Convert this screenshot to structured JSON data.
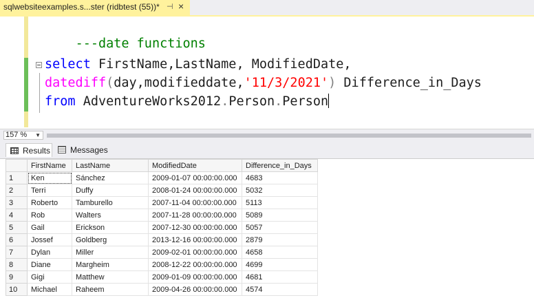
{
  "tab": {
    "title": "sqlwebsiteexamples.s...ster (ridbtest (55))*",
    "pin_glyph": "⊣",
    "close_glyph": "×"
  },
  "editor": {
    "comment": "---date functions",
    "line2": {
      "kw": "select",
      "rest": " FirstName,LastName, ModifiedDate,"
    },
    "line3": {
      "fn": "datediff",
      "p1": "(",
      "a1": "day,modifieddate,",
      "str": "'11/3/2021'",
      "p2": ")",
      "rest": " Difference_in_Days"
    },
    "line4": {
      "kw": "from",
      "db": " AdventureWorks2012",
      "d1": ".",
      "schema": "Person",
      "d2": ".",
      "table": "Person"
    }
  },
  "zoom": {
    "value": "157 %",
    "arrow": "▼"
  },
  "results_tabs": {
    "results": "Results",
    "messages": "Messages"
  },
  "grid": {
    "columns": [
      "FirstName",
      "LastName",
      "ModifiedDate",
      "Difference_in_Days"
    ],
    "rows": [
      [
        "1",
        "Ken",
        "Sánchez",
        "2009-01-07 00:00:00.000",
        "4683"
      ],
      [
        "2",
        "Terri",
        "Duffy",
        "2008-01-24 00:00:00.000",
        "5032"
      ],
      [
        "3",
        "Roberto",
        "Tamburello",
        "2007-11-04 00:00:00.000",
        "5113"
      ],
      [
        "4",
        "Rob",
        "Walters",
        "2007-11-28 00:00:00.000",
        "5089"
      ],
      [
        "5",
        "Gail",
        "Erickson",
        "2007-12-30 00:00:00.000",
        "5057"
      ],
      [
        "6",
        "Jossef",
        "Goldberg",
        "2013-12-16 00:00:00.000",
        "2879"
      ],
      [
        "7",
        "Dylan",
        "Miller",
        "2009-02-01 00:00:00.000",
        "4658"
      ],
      [
        "8",
        "Diane",
        "Margheim",
        "2008-12-22 00:00:00.000",
        "4699"
      ],
      [
        "9",
        "Gigi",
        "Matthew",
        "2009-01-09 00:00:00.000",
        "4681"
      ],
      [
        "10",
        "Michael",
        "Raheem",
        "2009-04-26 00:00:00.000",
        "4574"
      ]
    ]
  },
  "colors": {
    "tab_active": "#fff29d",
    "keyword": "#0000ff",
    "function": "#ff00ff",
    "string": "#ff0000",
    "comment": "#008000",
    "operator": "#808080"
  }
}
